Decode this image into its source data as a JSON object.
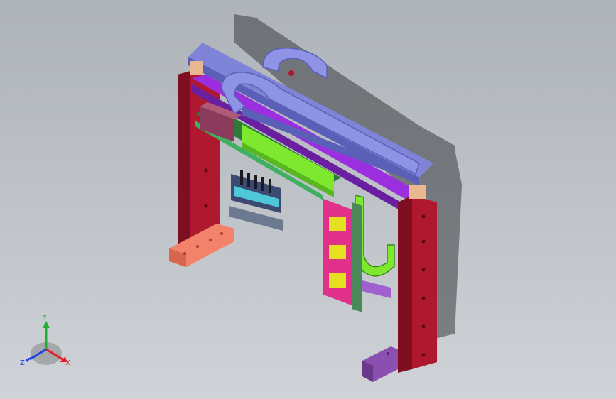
{
  "viewport": {
    "background_top": "#aeb3b9",
    "background_bottom": "#cfd3d7"
  },
  "model": {
    "colors": {
      "frame": "#b0182f",
      "frame_shade": "#7d0f20",
      "rail_blue": "#8e93e6",
      "rail_blue_dark": "#5a5fb8",
      "chain_green": "#7ee82f",
      "magenta": "#e0308a",
      "purple": "#9b2fe0",
      "salmon": "#f2826a",
      "violet_block": "#8a4fb0",
      "yellow": "#e5e020",
      "cyan": "#4ec7d8",
      "shadow": "#3a3d40"
    }
  },
  "triad": {
    "labels": {
      "x": "X",
      "y": "Y",
      "z": "Z"
    },
    "colors": {
      "x": "#e0202a",
      "y": "#20b030",
      "z": "#2040e0"
    }
  }
}
